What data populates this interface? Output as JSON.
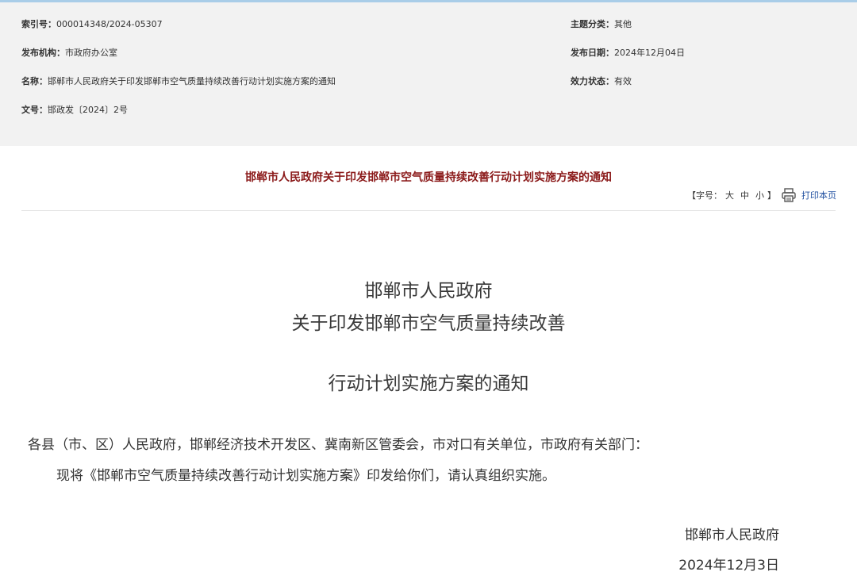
{
  "meta": {
    "index_label": "索引号：",
    "index_value": "000014348/2024-05307",
    "category_label": "主题分类：",
    "category_value": "其他",
    "publisher_label": "发布机构：",
    "publisher_value": "市政府办公室",
    "date_label": "发布日期：",
    "date_value": "2024年12月04日",
    "name_label": "名称：",
    "name_value": "邯郸市人民政府关于印发邯郸市空气质量持续改善行动计划实施方案的通知",
    "status_label": "效力状态：",
    "status_value": "有效",
    "docno_label": "文号：",
    "docno_value": "邯政发〔2024〕2号"
  },
  "heading": "邯郸市人民政府关于印发邯郸市空气质量持续改善行动计划实施方案的通知",
  "tools": {
    "font_size_label": "【字号：",
    "large": "大",
    "medium": "中",
    "small": "小",
    "close_bracket": "】",
    "print_label": "打印本页",
    "print_icon": "printer-icon"
  },
  "document": {
    "title_line1": "邯郸市人民政府",
    "title_line2": "关于印发邯郸市空气质量持续改善",
    "title_line3": "行动计划实施方案的通知",
    "recipients": "各县（市、区）人民政府，邯郸经济技术开发区、冀南新区管委会，市对口有关单位，市政府有关部门：",
    "body": "现将《邯郸市空气质量持续改善行动计划实施方案》印发给你们，请认真组织实施。",
    "signer": "邯郸市人民政府",
    "sign_date": "2024年12月3日"
  },
  "colors": {
    "heading": "#8b1a1a",
    "link": "#1f4fa0",
    "meta_bg": "#f2f2f2"
  }
}
